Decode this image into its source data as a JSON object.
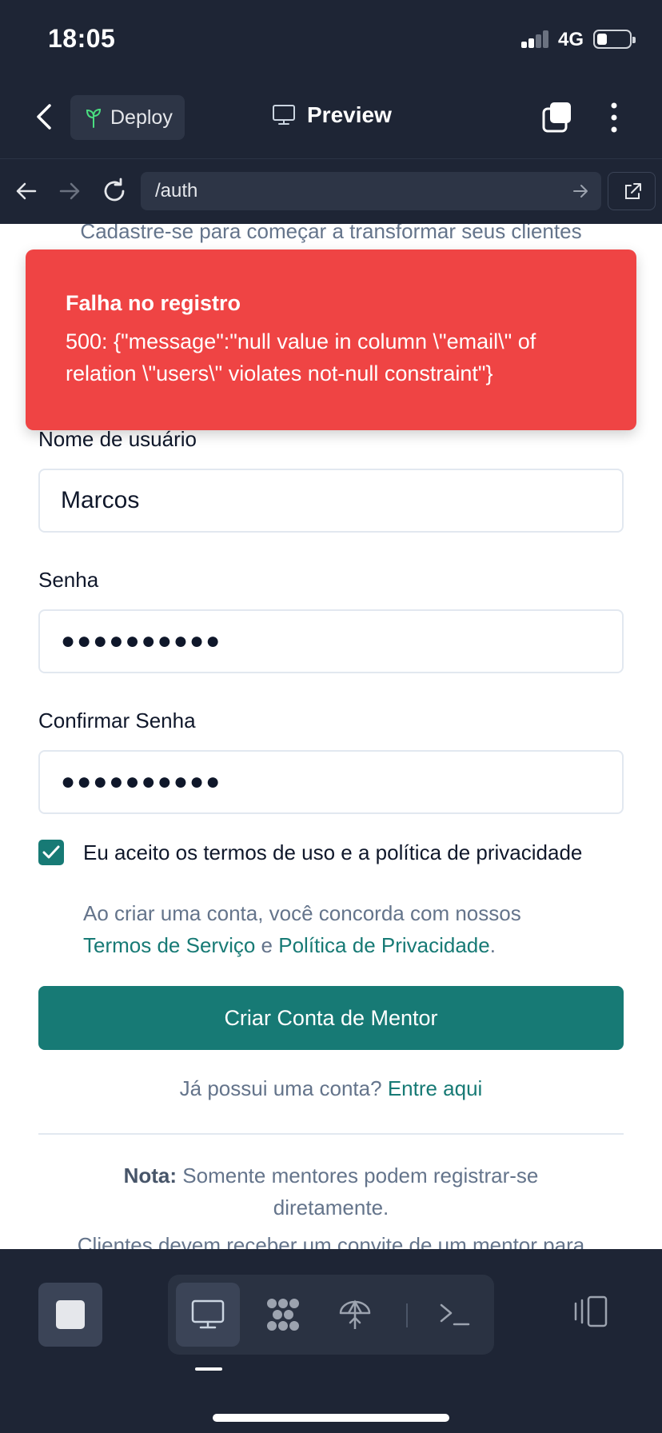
{
  "status_bar": {
    "time": "18:05",
    "network": "4G"
  },
  "header": {
    "deploy_label": "Deploy",
    "preview_label": "Preview"
  },
  "browser": {
    "url": "/auth"
  },
  "page": {
    "subtitle": "Cadastre-se para começar a transformar seus clientes",
    "username": {
      "label": "Nome de usuário",
      "value": "Marcos"
    },
    "password": {
      "label": "Senha",
      "masked_value": "●●●●●●●●●●"
    },
    "confirm_password": {
      "label": "Confirmar Senha",
      "masked_value": "●●●●●●●●●●"
    },
    "terms": {
      "checked": true,
      "label": "Eu aceito os termos de uso e a política de privacidade",
      "note_prefix": "Ao criar uma conta, você concorda com nossos",
      "terms_link": "Termos de Serviço",
      "and": "e",
      "privacy_link": "Política de Privacidade",
      "period": "."
    },
    "submit_label": "Criar Conta de Mentor",
    "login_prompt": "Já possui uma conta?",
    "login_link": "Entre aqui",
    "note_bold": "Nota:",
    "note_text": "Somente mentores podem registrar-se diretamente.",
    "note2": "Clientes devem receber um convite de um mentor para"
  },
  "toast": {
    "title": "Falha no registro",
    "message": "500: {\"message\":\"null value in column \\\"email\\\" of relation \\\"users\\\" violates not-null constraint\"}"
  },
  "colors": {
    "accent": "#177a75",
    "error": "#ef4444",
    "chrome": "#1e2535"
  },
  "icons": [
    "chevron-left-icon",
    "sprout-icon",
    "monitor-icon",
    "tabs-icon",
    "more-vertical-icon",
    "arrow-left-icon",
    "arrow-right-icon",
    "reload-icon",
    "external-link-icon",
    "stop-icon",
    "workflow-icon",
    "deploy-icon",
    "terminal-icon",
    "side-panel-icon"
  ]
}
